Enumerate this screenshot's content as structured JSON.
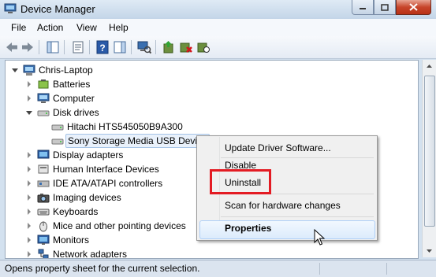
{
  "window": {
    "title": "Device Manager"
  },
  "colors": {
    "highlight_box": "#e31b23",
    "selection": "#a5c3e6"
  },
  "menubar": {
    "file": "File",
    "action": "Action",
    "view": "View",
    "help": "Help"
  },
  "toolbar": {
    "icons": [
      "back-icon",
      "forward-icon",
      "show-hide-console-tree-icon",
      "properties-icon",
      "help-icon",
      "show-hide-action-pane-icon",
      "update-driver-icon",
      "uninstall-icon",
      "scan-hardware-icon"
    ]
  },
  "tree": {
    "root": "Chris-Laptop",
    "items": [
      {
        "label": "Batteries"
      },
      {
        "label": "Computer"
      },
      {
        "label": "Disk drives",
        "children": [
          "Hitachi HTS545050B9A300",
          "Sony Storage Media USB Device"
        ]
      },
      {
        "label": "Display adapters"
      },
      {
        "label": "Human Interface Devices"
      },
      {
        "label": "IDE ATA/ATAPI controllers"
      },
      {
        "label": "Imaging devices"
      },
      {
        "label": "Keyboards"
      },
      {
        "label": "Mice and other pointing devices"
      },
      {
        "label": "Monitors"
      },
      {
        "label": "Network adapters"
      }
    ]
  },
  "context_menu": {
    "items": [
      "Update Driver Software...",
      "Disable",
      "Uninstall",
      "Scan for hardware changes",
      "Properties"
    ]
  },
  "status": {
    "text": "Opens property sheet for the current selection."
  }
}
